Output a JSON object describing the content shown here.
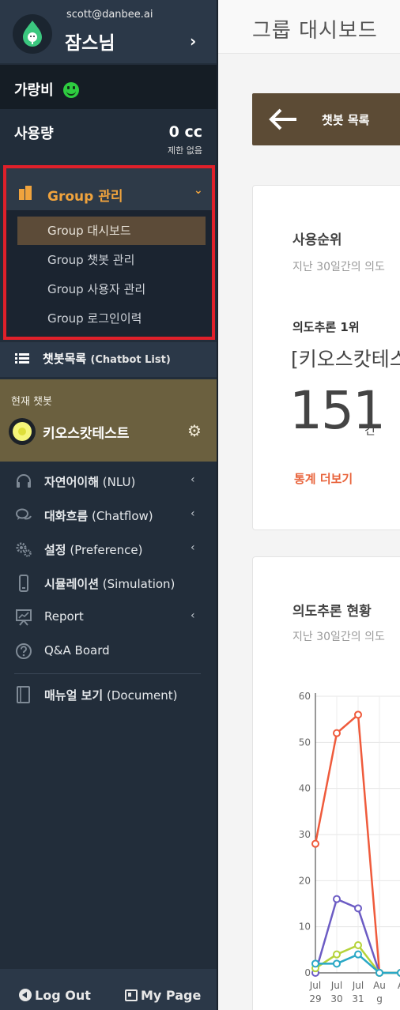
{
  "user": {
    "email": "scott@danbee.ai",
    "name": "잠스님",
    "chevron": "›"
  },
  "plan": {
    "label": "가랑비",
    "status_icon": "smile-icon"
  },
  "usage": {
    "label": "사용량",
    "value": "0 cc",
    "limit": "제한 없음"
  },
  "group": {
    "title": "Group 관리",
    "caret": "⌄",
    "items": [
      {
        "label": "Group 대시보드",
        "active": true
      },
      {
        "label": "Group 챗봇 관리",
        "active": false
      },
      {
        "label": "Group 사용자 관리",
        "active": false
      },
      {
        "label": "Group 로그인이력",
        "active": false
      }
    ]
  },
  "chatbot_list": {
    "label": "챗봇목록",
    "sub": "(Chatbot List)"
  },
  "current_bot": {
    "title": "현재 챗봇",
    "name": "키오스캇테스트"
  },
  "menu": {
    "items": [
      {
        "label_ko": "자연어이해",
        "label_en": "(NLU)",
        "icon": "headset-icon",
        "has_caret": true
      },
      {
        "label_ko": "대화흐름",
        "label_en": "(Chatflow)",
        "icon": "chat-bubbles-icon",
        "has_caret": true
      },
      {
        "label_ko": "설정",
        "label_en": "(Preference)",
        "icon": "gears-icon",
        "has_caret": true
      },
      {
        "label_ko": "시뮬레이션",
        "label_en": "(Simulation)",
        "icon": "phone-icon",
        "has_caret": false
      },
      {
        "label_ko": "",
        "label_en": "Report",
        "icon": "presentation-chart-icon",
        "has_caret": true
      },
      {
        "label_ko": "",
        "label_en": "Q&A Board",
        "icon": "question-circle-icon",
        "has_caret": false
      },
      {
        "label_ko": "매뉴얼 보기",
        "label_en": "(Document)",
        "icon": "book-icon",
        "has_caret": false
      }
    ],
    "caret": "‹"
  },
  "bottom": {
    "logout": "Log Out",
    "mypage": "My Page"
  },
  "main": {
    "page_title": "그룹 대시보드",
    "back_button": "챗봇 목록",
    "card1": {
      "title": "사용순위",
      "subtitle": "지난 30일간의 의도",
      "rank_label": "의도추론 1위",
      "rank_name": "[키오스캇테스",
      "rank_count": "151",
      "rank_unit": "건",
      "more_link": "통계 더보기"
    },
    "card2": {
      "title": "의도추론 현황",
      "subtitle": "지난 30일간의 의도"
    }
  },
  "colors": {
    "sidebar_bg": "#222d3a",
    "accent_orange": "#f0a33d",
    "highlight_red": "#e0202a",
    "bot_bar": "#6b603f",
    "button_brown": "#5c4b35",
    "link_orange": "#e8643c"
  },
  "chart_data": {
    "type": "line",
    "categories": [
      "Jul 29",
      "Jul 30",
      "Jul 31",
      "Aug",
      "A"
    ],
    "x_tick_lines": [
      [
        "Jul",
        "29"
      ],
      [
        "Jul",
        "30"
      ],
      [
        "Jul",
        "31"
      ],
      [
        "Au",
        "g"
      ],
      [
        "A",
        ""
      ]
    ],
    "ylim": [
      0,
      60
    ],
    "yticks": [
      0,
      10,
      20,
      30,
      40,
      50,
      60
    ],
    "grid": true,
    "series": [
      {
        "color": "#ef5b3c",
        "values": [
          28,
          52,
          56,
          0,
          0
        ]
      },
      {
        "color": "#6c5cc4",
        "values": [
          0,
          16,
          14,
          0,
          0
        ]
      },
      {
        "color": "#b5d33a",
        "values": [
          1,
          4,
          6,
          0,
          0
        ]
      },
      {
        "color": "#2aa8c6",
        "values": [
          2,
          2,
          4,
          0,
          0
        ]
      }
    ]
  }
}
